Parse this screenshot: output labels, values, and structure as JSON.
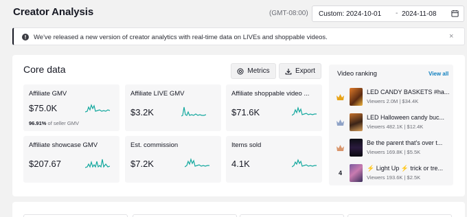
{
  "header": {
    "title": "Creator Analysis",
    "timezone": "(GMT-08:00)",
    "date_start": "Custom: 2024-10-01",
    "date_sep": "-",
    "date_end": "2024-11-08"
  },
  "notice": {
    "message": "We've released a new version of creator analytics with real-time data on LIVEs and shoppable videos.",
    "close": "×"
  },
  "core": {
    "title": "Core data",
    "metrics_label": "Metrics",
    "export_label": "Export",
    "cards": [
      {
        "label": "Affiliate GMV",
        "value": "$75.0K",
        "sub_pct": "96.91%",
        "sub_text": "of seller GMV"
      },
      {
        "label": "Affiliate LIVE GMV",
        "value": "$3.2K"
      },
      {
        "label": "Affiliate shoppable video ...",
        "value": "$71.6K"
      },
      {
        "label": "Affiliate showcase GMV",
        "value": "$207.67"
      },
      {
        "label": "Est. commission",
        "value": "$7.2K"
      },
      {
        "label": "Items sold",
        "value": "4.1K"
      }
    ]
  },
  "ranking": {
    "title": "Video ranking",
    "view_all": "View all",
    "items": [
      {
        "rank": "1",
        "name": "LED CANDY BASKETS #ha...",
        "viewers": "Viewers 2.0M",
        "gmv": "$34.4K",
        "medal_color": "#e8a317"
      },
      {
        "rank": "2",
        "name": "LED Halloween candy buc...",
        "viewers": "Viewers 482.1K",
        "gmv": "$12.4K",
        "medal_color": "#8fa3c7"
      },
      {
        "rank": "3",
        "name": "Be the parent that's over t...",
        "viewers": "Viewers 169.8K",
        "gmv": "$5.5K",
        "medal_color": "#d9956b"
      },
      {
        "rank": "4",
        "name": "⚡ Light Up ⚡ trick or tre...",
        "viewers": "Viewers 193.6K",
        "gmv": "$2.5K"
      }
    ]
  },
  "colors": {
    "accent_teal": "#13a89e",
    "link_blue": "#0f7fbf"
  },
  "icons": {
    "calendar": "calendar-icon",
    "info": "info-icon",
    "metrics": "settings-icon",
    "export": "download-icon",
    "medal": "crown-icon"
  }
}
